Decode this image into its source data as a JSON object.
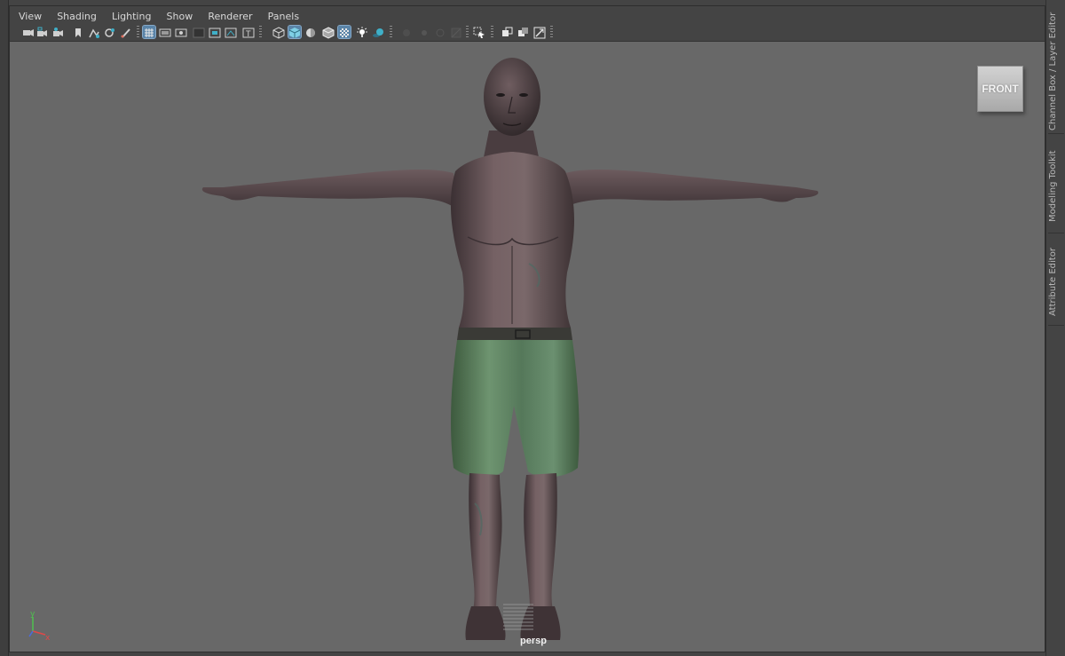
{
  "menubar": {
    "items": [
      "View",
      "Shading",
      "Lighting",
      "Show",
      "Renderer",
      "Panels"
    ]
  },
  "viewport": {
    "view_cube_label": "FRONT",
    "camera_label": "persp",
    "axis": {
      "y_label": "y",
      "x_label": "x"
    },
    "colors": {
      "background": "#686868",
      "skin": "#6a5658",
      "shorts": "#5f8560"
    }
  },
  "right_dock": {
    "tabs": [
      "Channel Box / Layer Editor",
      "Modeling Toolkit",
      "Attribute Editor"
    ]
  }
}
